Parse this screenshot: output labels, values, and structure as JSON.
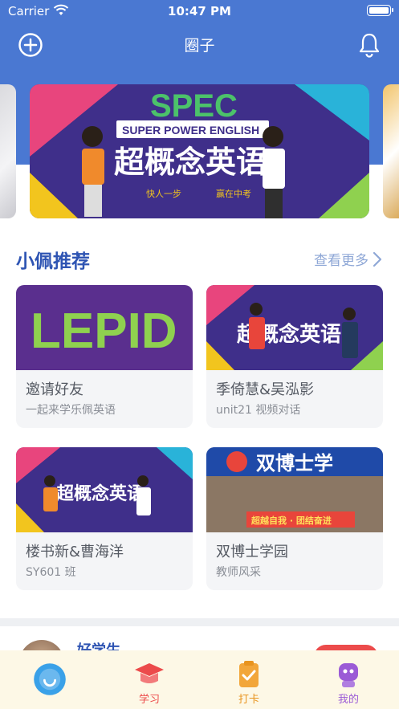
{
  "status_bar": {
    "carrier": "Carrier",
    "time": "10:47 PM"
  },
  "nav": {
    "title": "圈子",
    "add_icon": "plus-circle-icon",
    "bell_icon": "bell-icon"
  },
  "banner": {
    "brand": "SPEC",
    "subtitle": "SUPER POWER ENGLISH",
    "slogan": "超概念英语",
    "motto_left": "快人一步",
    "motto_right": "赢在中考"
  },
  "recommend": {
    "title": "小佩推荐",
    "see_more": "查看更多",
    "cards": [
      {
        "title": "邀请好友",
        "subtitle": "一起来学乐佩英语",
        "image_text": "LEPID"
      },
      {
        "title": "季倚慧&吴泓影",
        "subtitle": "unit21 视频对话",
        "image_text": "超概念英语"
      },
      {
        "title": "楼书新&曹海洋",
        "subtitle": "SY601 班",
        "image_text": "超概念英语"
      },
      {
        "title": "双博士学园",
        "subtitle": "教师风采",
        "image_text": "双博士学",
        "banner_text": "超越自我 · 团结奋进"
      }
    ]
  },
  "peek": {
    "name": "好学生"
  },
  "tabs": [
    {
      "label": "",
      "icon": "home-bubble-icon",
      "color": "#3aa1e8"
    },
    {
      "label": "学习",
      "icon": "graduation-cap-icon",
      "color": "#ec4b4b"
    },
    {
      "label": "打卡",
      "icon": "clipboard-check-icon",
      "color": "#e8941f"
    },
    {
      "label": "我的",
      "icon": "robot-avatar-icon",
      "color": "#9b5bd6"
    }
  ]
}
